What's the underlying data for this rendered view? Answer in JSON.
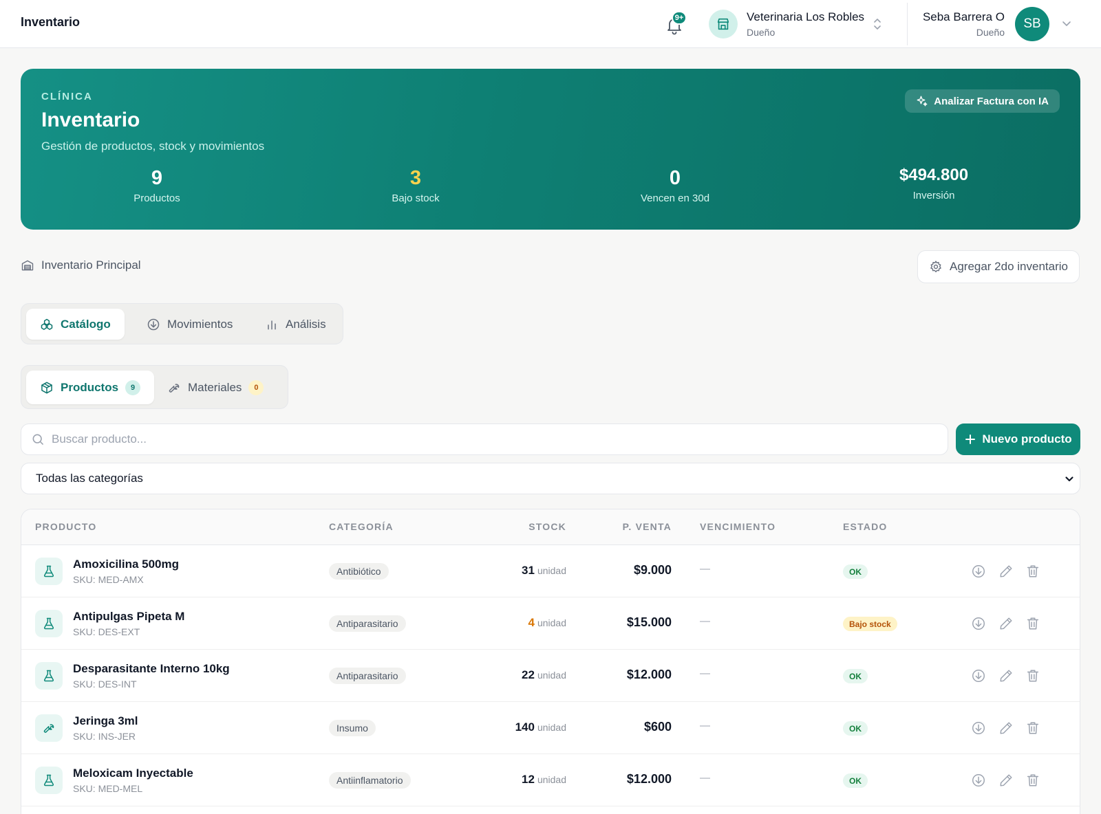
{
  "topbar": {
    "title": "Inventario",
    "notification_badge": "9+",
    "clinic_name": "Veterinaria Los Robles",
    "clinic_role": "Dueño",
    "user_name": "Seba Barrera O",
    "user_role": "Dueño",
    "user_initials": "SB"
  },
  "hero": {
    "kicker": "CLÍNICA",
    "title": "Inventario",
    "subtitle": "Gestión de productos, stock y movimientos",
    "ai_button": "Analizar Factura con IA",
    "stats": [
      {
        "value": "9",
        "label": "Productos",
        "color": "#ffffff"
      },
      {
        "value": "3",
        "label": "Bajo stock",
        "color": "#fcd34d"
      },
      {
        "value": "0",
        "label": "Vencen en 30d",
        "color": "#ffffff"
      },
      {
        "value": "$494.800",
        "label": "Inversión",
        "color": "#ffffff"
      }
    ]
  },
  "inventory": {
    "main_label": "Inventario Principal",
    "add_button": "Agregar 2do inventario"
  },
  "tabs": [
    {
      "label": "Catálogo",
      "icon": "catalog-icon",
      "active": true
    },
    {
      "label": "Movimientos",
      "icon": "movements-icon",
      "active": false
    },
    {
      "label": "Análisis",
      "icon": "analysis-icon",
      "active": false
    }
  ],
  "subtabs": [
    {
      "label": "Productos",
      "count": "9",
      "active": true
    },
    {
      "label": "Materiales",
      "count": "0",
      "active": false
    }
  ],
  "search": {
    "placeholder": "Buscar producto...",
    "value": ""
  },
  "new_button": "Nuevo producto",
  "category_filter": {
    "selected": "Todas las categorías"
  },
  "table": {
    "headers": {
      "producto": "PRODUCTO",
      "categoria": "CATEGORÍA",
      "stock": "STOCK",
      "precio": "P. VENTA",
      "vencimiento": "VENCIMIENTO",
      "estado": "ESTADO"
    },
    "rows": [
      {
        "name": "Amoxicilina 500mg",
        "sku": "SKU: MED-AMX",
        "category": "Antibiótico",
        "stock": "31",
        "unit": "unidad",
        "low": false,
        "price": "$9.000",
        "expiry": "—",
        "status": "OK",
        "icon": "flask-icon"
      },
      {
        "name": "Antipulgas Pipeta M",
        "sku": "SKU: DES-EXT",
        "category": "Antiparasitario",
        "stock": "4",
        "unit": "unidad",
        "low": true,
        "price": "$15.000",
        "expiry": "—",
        "status": "Bajo stock",
        "icon": "flask-icon"
      },
      {
        "name": "Desparasitante Interno 10kg",
        "sku": "SKU: DES-INT",
        "category": "Antiparasitario",
        "stock": "22",
        "unit": "unidad",
        "low": false,
        "price": "$12.000",
        "expiry": "—",
        "status": "OK",
        "icon": "flask-icon"
      },
      {
        "name": "Jeringa 3ml",
        "sku": "SKU: INS-JER",
        "category": "Insumo",
        "stock": "140",
        "unit": "unidad",
        "low": false,
        "price": "$600",
        "expiry": "—",
        "status": "OK",
        "icon": "wrench-icon"
      },
      {
        "name": "Meloxicam Inyectable",
        "sku": "SKU: MED-MEL",
        "category": "Antiinflamatorio",
        "stock": "12",
        "unit": "unidad",
        "low": false,
        "price": "$12.000",
        "expiry": "—",
        "status": "OK",
        "icon": "flask-icon"
      }
    ]
  },
  "colors": {
    "brand": "#0f8a7a",
    "warning": "#d97706",
    "ok": "#15803d"
  }
}
